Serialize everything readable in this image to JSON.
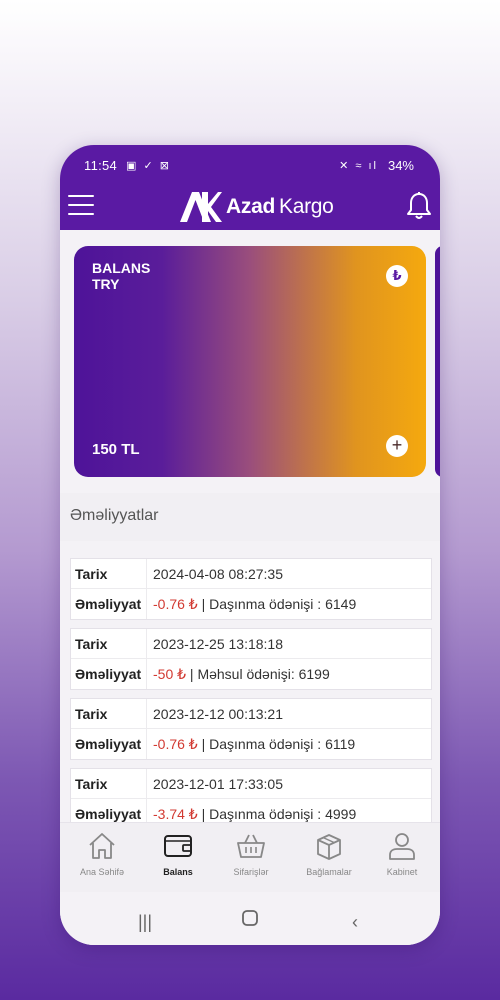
{
  "status": {
    "time": "11:54",
    "left_icons": "▣ ✓ ⊠",
    "right_icons": "✕ ≈ ıl",
    "battery": "34%"
  },
  "header": {
    "logo_bold": "Azad",
    "logo_light": "Kargo"
  },
  "balance_card": {
    "title_line1": "BALANS",
    "title_line2": "TRY",
    "amount": "150 TL",
    "currency_symbol": "₺",
    "add_symbol": "+"
  },
  "section": {
    "title": "Əməliyyatlar"
  },
  "labels": {
    "date": "Tarix",
    "operation": "Əməliyyat"
  },
  "transactions": [
    {
      "date": "2024-04-08 08:27:35",
      "amount": "-0.76 ₺",
      "description": " | Daşınma ödənişi : 6149"
    },
    {
      "date": "2023-12-25 13:18:18",
      "amount": "-50 ₺",
      "description": " | Məhsul ödənişi: 6199"
    },
    {
      "date": "2023-12-12 00:13:21",
      "amount": "-0.76 ₺",
      "description": " | Daşınma ödənişi : 6119"
    },
    {
      "date": "2023-12-01 17:33:05",
      "amount": "-3.74 ₺",
      "description": " | Daşınma ödənişi : 4999"
    }
  ],
  "nav": [
    {
      "label": "Ana Səhifə",
      "icon": "home-icon"
    },
    {
      "label": "Balans",
      "icon": "wallet-icon"
    },
    {
      "label": "Sifarişlər",
      "icon": "basket-icon"
    },
    {
      "label": "Bağlamalar",
      "icon": "box-icon"
    },
    {
      "label": "Kabinet",
      "icon": "user-icon"
    }
  ],
  "colors": {
    "brand": "#5a1aa3",
    "negative": "#d23a32",
    "accent": "#f5a90e"
  }
}
